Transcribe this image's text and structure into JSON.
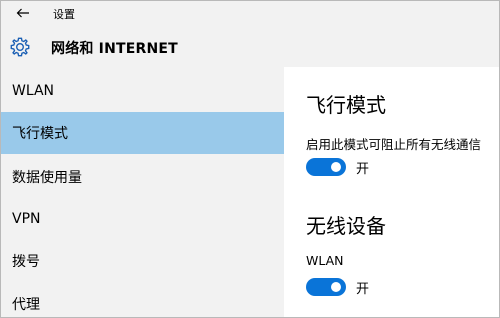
{
  "window": {
    "title": "设置",
    "back_icon": "back-arrow-icon"
  },
  "header": {
    "icon": "gear-icon",
    "title": "网络和 INTERNET"
  },
  "sidebar": {
    "items": [
      {
        "label": "WLAN",
        "selected": false
      },
      {
        "label": "飞行模式",
        "selected": true
      },
      {
        "label": "数据使用量",
        "selected": false
      },
      {
        "label": "VPN",
        "selected": false
      },
      {
        "label": "拨号",
        "selected": false
      },
      {
        "label": "代理",
        "selected": false
      }
    ],
    "selected_color": "#99c9ea"
  },
  "content": {
    "airplane": {
      "heading": "飞行模式",
      "description": "启用此模式可阻止所有无线通信",
      "toggle": {
        "state": "on",
        "label": "开"
      }
    },
    "wireless": {
      "heading": "无线设备",
      "wlan_label": "WLAN",
      "toggle": {
        "state": "on",
        "label": "开"
      }
    }
  },
  "colors": {
    "accent": "#0a74d8",
    "panel_bg": "#f2f2f2"
  }
}
